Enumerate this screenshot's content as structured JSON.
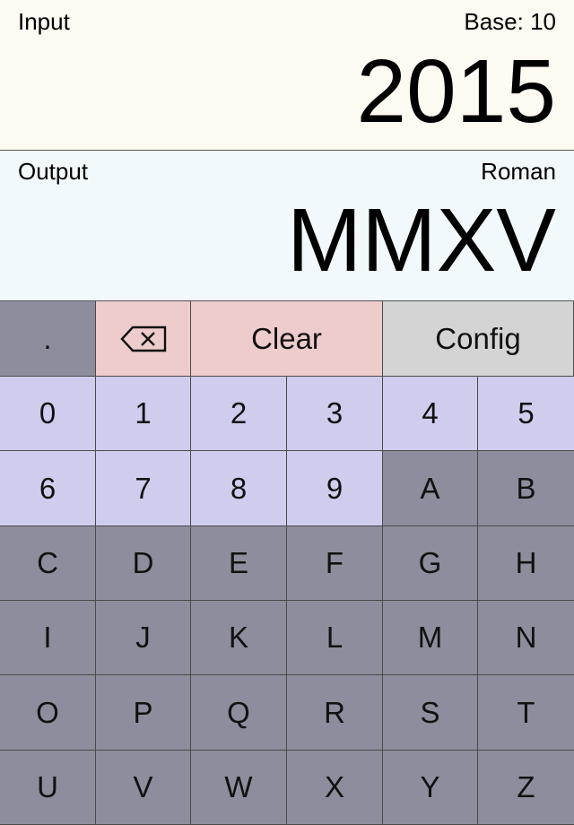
{
  "input": {
    "label": "Input",
    "base_label": "Base: 10",
    "value": "2015"
  },
  "output": {
    "label": "Output",
    "format_label": "Roman",
    "value": "MMXV"
  },
  "controls": {
    "dot_label": ".",
    "backspace_icon": "backspace-icon",
    "clear_label": "Clear",
    "config_label": "Config"
  },
  "keys": [
    "0",
    "1",
    "2",
    "3",
    "4",
    "5",
    "6",
    "7",
    "8",
    "9",
    "A",
    "B",
    "C",
    "D",
    "E",
    "F",
    "G",
    "H",
    "I",
    "J",
    "K",
    "L",
    "M",
    "N",
    "O",
    "P",
    "Q",
    "R",
    "S",
    "T",
    "U",
    "V",
    "W",
    "X",
    "Y",
    "Z"
  ],
  "colors": {
    "input_bg": "#fdfaf2",
    "output_bg": "#f2f9fc",
    "digit_key": "#cfcdee",
    "letter_key": "#8e8d9d",
    "clear_key": "#eecccc",
    "config_key": "#d4d4d4"
  }
}
